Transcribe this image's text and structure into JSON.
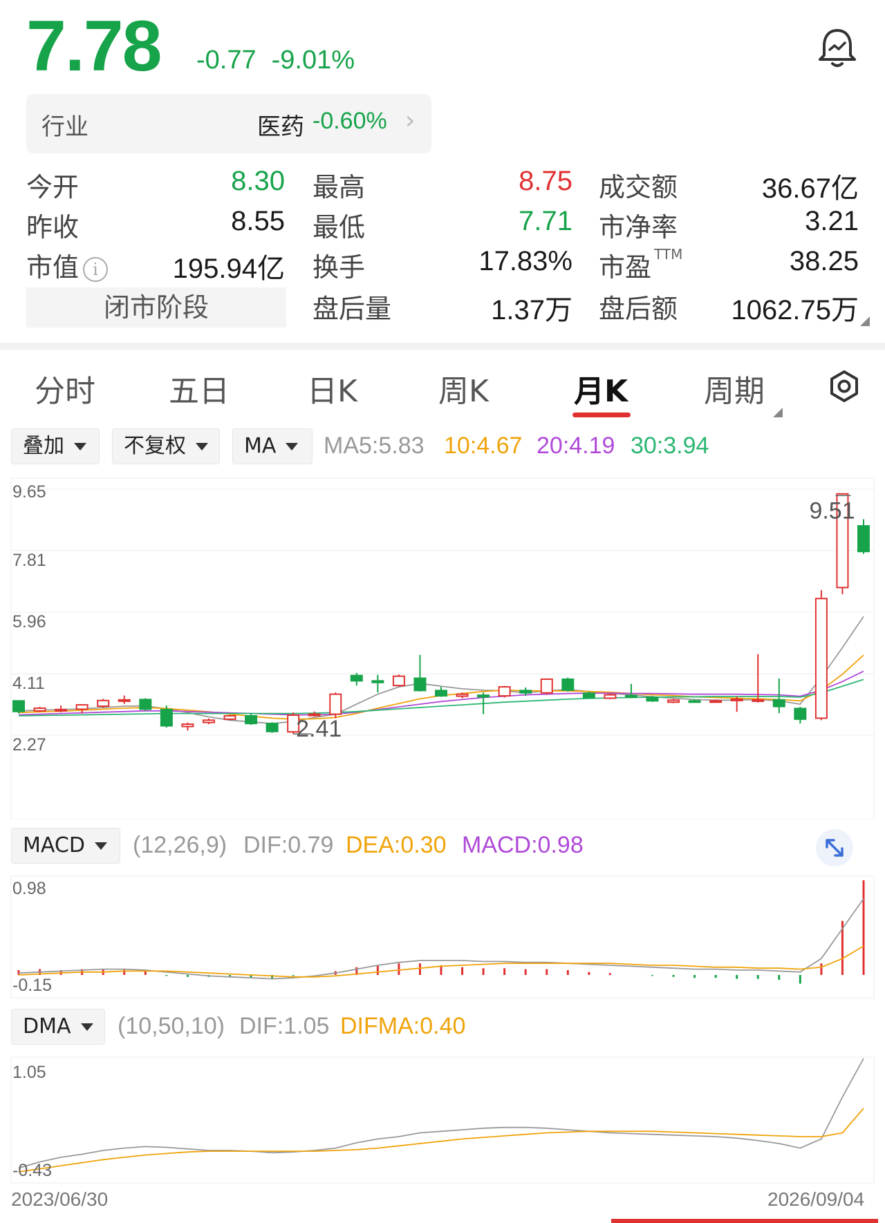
{
  "quote": {
    "price": "7.78",
    "change": "-0.77",
    "change_pct": "-9.01%"
  },
  "industry": {
    "label": "行业",
    "name": "医药",
    "pct": "-0.60%"
  },
  "stats": {
    "open_label": "今开",
    "open": "8.30",
    "prev_label": "昨收",
    "prev": "8.55",
    "mcap_label": "市值",
    "mcap": "195.94亿",
    "session": "闭市阶段",
    "high_label": "最高",
    "high": "8.75",
    "low_label": "最低",
    "low": "7.71",
    "turnover_label": "换手",
    "turnover": "17.83%",
    "after_vol_label": "盘后量",
    "after_vol": "1.37万",
    "amount_label": "成交额",
    "amount": "36.67亿",
    "pb_label": "市净率",
    "pb": "3.21",
    "pe_label": "市盈",
    "pe_sup": "TTM",
    "pe": "38.25",
    "after_amt_label": "盘后额",
    "after_amt": "1062.75万"
  },
  "tabs": [
    "分时",
    "五日",
    "日K",
    "周K",
    "月K",
    "周期"
  ],
  "active_tab": "月K",
  "controls": {
    "overlay": "叠加",
    "adjust": "不复权",
    "ma": "MA"
  },
  "ma_legend": {
    "ma5": "MA5:5.83",
    "ma10": "10:4.67",
    "ma20": "20:4.19",
    "ma30": "30:3.94"
  },
  "macd_header": {
    "name": "MACD",
    "params": "(12,26,9)",
    "dif": "DIF:0.79",
    "dea": "DEA:0.30",
    "macd": "MACD:0.98"
  },
  "dma_header": {
    "name": "DMA",
    "params": "(10,50,10)",
    "dif": "DIF:1.05",
    "difma": "DIFMA:0.40"
  },
  "dates": {
    "start": "2023/06/30",
    "end": "2026/09/04"
  },
  "colors": {
    "up": "#e03131",
    "down": "#17a34a",
    "ma5": "#999999",
    "ma10": "#f0a30a",
    "ma20": "#b04ad8",
    "ma30": "#2bb673"
  },
  "chart_data": [
    {
      "type": "candlestick",
      "title": "月K",
      "y_ticks": [
        "9.65",
        "7.81",
        "5.96",
        "4.11",
        "2.27"
      ],
      "ylim": [
        2.27,
        9.65
      ],
      "annotations": [
        {
          "label": "9.51",
          "kind": "max"
        },
        {
          "label": "2.41",
          "kind": "min"
        }
      ],
      "candles": [
        {
          "o": 3.3,
          "c": 2.98,
          "h": 3.32,
          "l": 2.92
        },
        {
          "o": 3.0,
          "c": 3.08,
          "h": 3.12,
          "l": 2.96
        },
        {
          "o": 3.02,
          "c": 3.04,
          "h": 3.16,
          "l": 2.96
        },
        {
          "o": 3.05,
          "c": 3.18,
          "h": 3.2,
          "l": 2.92
        },
        {
          "o": 3.14,
          "c": 3.31,
          "h": 3.36,
          "l": 3.09
        },
        {
          "o": 3.29,
          "c": 3.33,
          "h": 3.46,
          "l": 3.21
        },
        {
          "o": 3.34,
          "c": 3.05,
          "h": 3.38,
          "l": 3.0
        },
        {
          "o": 3.04,
          "c": 2.55,
          "h": 3.16,
          "l": 2.5
        },
        {
          "o": 2.53,
          "c": 2.6,
          "h": 2.65,
          "l": 2.41
        },
        {
          "o": 2.65,
          "c": 2.72,
          "h": 2.77,
          "l": 2.6
        },
        {
          "o": 2.75,
          "c": 2.85,
          "h": 2.88,
          "l": 2.72
        },
        {
          "o": 2.85,
          "c": 2.62,
          "h": 2.92,
          "l": 2.58
        },
        {
          "o": 2.62,
          "c": 2.38,
          "h": 2.66,
          "l": 2.34
        },
        {
          "o": 2.37,
          "c": 2.87,
          "h": 2.95,
          "l": 2.31
        },
        {
          "o": 2.87,
          "c": 2.9,
          "h": 2.98,
          "l": 2.83
        },
        {
          "o": 2.9,
          "c": 3.5,
          "h": 3.55,
          "l": 2.78
        },
        {
          "o": 4.06,
          "c": 3.9,
          "h": 4.14,
          "l": 3.76
        },
        {
          "o": 3.9,
          "c": 3.85,
          "h": 4.08,
          "l": 3.55
        },
        {
          "o": 3.76,
          "c": 4.04,
          "h": 4.09,
          "l": 3.73
        },
        {
          "o": 3.98,
          "c": 3.61,
          "h": 4.68,
          "l": 3.58
        },
        {
          "o": 3.61,
          "c": 3.45,
          "h": 3.72,
          "l": 3.42
        },
        {
          "o": 3.44,
          "c": 3.5,
          "h": 3.55,
          "l": 3.38
        },
        {
          "o": 3.47,
          "c": 3.42,
          "h": 3.55,
          "l": 2.9
        },
        {
          "o": 3.45,
          "c": 3.72,
          "h": 3.75,
          "l": 3.4
        },
        {
          "o": 3.61,
          "c": 3.54,
          "h": 3.7,
          "l": 3.45
        },
        {
          "o": 3.54,
          "c": 3.95,
          "h": 3.97,
          "l": 3.49
        },
        {
          "o": 3.95,
          "c": 3.62,
          "h": 4.0,
          "l": 3.58
        },
        {
          "o": 3.53,
          "c": 3.4,
          "h": 3.58,
          "l": 3.37
        },
        {
          "o": 3.38,
          "c": 3.48,
          "h": 3.52,
          "l": 3.35
        },
        {
          "o": 3.46,
          "c": 3.41,
          "h": 3.81,
          "l": 3.38
        },
        {
          "o": 3.41,
          "c": 3.3,
          "h": 3.45,
          "l": 3.27
        },
        {
          "o": 3.26,
          "c": 3.32,
          "h": 3.36,
          "l": 3.23
        },
        {
          "o": 3.3,
          "c": 3.28,
          "h": 3.34,
          "l": 3.25
        },
        {
          "o": 3.28,
          "c": 3.3,
          "h": 3.34,
          "l": 3.25
        },
        {
          "o": 3.32,
          "c": 3.35,
          "h": 3.43,
          "l": 2.97
        },
        {
          "o": 3.32,
          "c": 3.33,
          "h": 4.7,
          "l": 3.25
        },
        {
          "o": 3.33,
          "c": 3.13,
          "h": 3.97,
          "l": 2.93
        },
        {
          "o": 3.07,
          "c": 2.75,
          "h": 3.12,
          "l": 2.62
        },
        {
          "o": 2.78,
          "c": 6.37,
          "h": 6.62,
          "l": 2.72
        },
        {
          "o": 6.7,
          "c": 9.51,
          "h": 9.52,
          "l": 6.5
        },
        {
          "o": 8.55,
          "c": 7.78,
          "h": 8.75,
          "l": 7.71
        }
      ],
      "ma_series": [
        {
          "name": "MA5",
          "values": [
            3.0,
            3.02,
            3.04,
            3.06,
            3.1,
            3.14,
            3.15,
            3.06,
            2.95,
            2.82,
            2.72,
            2.67,
            2.62,
            2.68,
            2.8,
            2.9,
            3.2,
            3.5,
            3.72,
            3.82,
            3.74,
            3.66,
            3.62,
            3.6,
            3.54,
            3.6,
            3.64,
            3.58,
            3.52,
            3.48,
            3.42,
            3.38,
            3.34,
            3.32,
            3.32,
            3.34,
            3.3,
            3.2,
            4.0,
            4.9,
            5.83
          ]
        },
        {
          "name": "10",
          "values": [
            2.95,
            2.97,
            2.99,
            3.02,
            3.05,
            3.08,
            3.1,
            3.07,
            3.02,
            2.97,
            2.9,
            2.84,
            2.78,
            2.75,
            2.76,
            2.8,
            2.92,
            3.08,
            3.22,
            3.36,
            3.46,
            3.52,
            3.58,
            3.62,
            3.6,
            3.6,
            3.6,
            3.58,
            3.56,
            3.52,
            3.48,
            3.46,
            3.42,
            3.4,
            3.38,
            3.36,
            3.34,
            3.3,
            3.62,
            4.1,
            4.67
          ]
        },
        {
          "name": "20",
          "values": [
            2.88,
            2.9,
            2.92,
            2.94,
            2.96,
            2.98,
            3.0,
            3.0,
            2.98,
            2.96,
            2.94,
            2.92,
            2.9,
            2.88,
            2.88,
            2.9,
            2.96,
            3.04,
            3.12,
            3.2,
            3.28,
            3.34,
            3.4,
            3.44,
            3.48,
            3.5,
            3.52,
            3.53,
            3.53,
            3.52,
            3.52,
            3.51,
            3.5,
            3.5,
            3.5,
            3.49,
            3.48,
            3.44,
            3.62,
            3.88,
            4.19
          ]
        },
        {
          "name": "30",
          "values": [
            2.85,
            2.86,
            2.87,
            2.88,
            2.89,
            2.9,
            2.91,
            2.92,
            2.92,
            2.92,
            2.92,
            2.92,
            2.92,
            2.92,
            2.93,
            2.95,
            2.98,
            3.02,
            3.06,
            3.1,
            3.14,
            3.18,
            3.22,
            3.26,
            3.29,
            3.32,
            3.35,
            3.37,
            3.39,
            3.4,
            3.41,
            3.42,
            3.42,
            3.43,
            3.43,
            3.43,
            3.43,
            3.41,
            3.54,
            3.74,
            3.94
          ]
        }
      ]
    },
    {
      "type": "bar",
      "title": "MACD",
      "y_ticks": [
        "0.98",
        "-0.15"
      ],
      "ylim": [
        -0.15,
        0.98
      ],
      "macd_bars": [
        0.05,
        0.06,
        0.05,
        0.06,
        0.06,
        0.06,
        0.04,
        -0.01,
        -0.02,
        -0.02,
        -0.02,
        -0.03,
        -0.04,
        -0.01,
        0.0,
        0.04,
        0.08,
        0.1,
        0.12,
        0.12,
        0.1,
        0.08,
        0.07,
        0.07,
        0.06,
        0.06,
        0.05,
        0.03,
        0.02,
        0.0,
        -0.01,
        -0.02,
        -0.03,
        -0.03,
        -0.04,
        -0.04,
        -0.05,
        -0.09,
        0.12,
        0.56,
        0.98
      ],
      "series": [
        {
          "name": "DIF",
          "values": [
            0.02,
            0.03,
            0.04,
            0.05,
            0.06,
            0.06,
            0.05,
            0.03,
            0.01,
            -0.01,
            -0.02,
            -0.03,
            -0.04,
            -0.03,
            -0.01,
            0.02,
            0.06,
            0.1,
            0.13,
            0.15,
            0.15,
            0.15,
            0.14,
            0.14,
            0.13,
            0.13,
            0.12,
            0.11,
            0.1,
            0.09,
            0.08,
            0.07,
            0.06,
            0.06,
            0.05,
            0.05,
            0.04,
            0.03,
            0.17,
            0.48,
            0.79
          ]
        },
        {
          "name": "DEA",
          "values": [
            0.0,
            0.01,
            0.02,
            0.03,
            0.03,
            0.04,
            0.04,
            0.04,
            0.03,
            0.02,
            0.01,
            0.0,
            -0.01,
            -0.02,
            -0.02,
            -0.01,
            0.01,
            0.03,
            0.05,
            0.07,
            0.09,
            0.1,
            0.11,
            0.12,
            0.12,
            0.12,
            0.12,
            0.12,
            0.12,
            0.11,
            0.1,
            0.1,
            0.09,
            0.08,
            0.08,
            0.07,
            0.07,
            0.06,
            0.08,
            0.17,
            0.3
          ]
        }
      ]
    },
    {
      "type": "line",
      "title": "DMA",
      "y_ticks": [
        "1.05",
        "-0.43"
      ],
      "ylim": [
        -0.43,
        1.05
      ],
      "series": [
        {
          "name": "DIF",
          "values": [
            -0.38,
            -0.3,
            -0.24,
            -0.2,
            -0.15,
            -0.12,
            -0.1,
            -0.11,
            -0.13,
            -0.15,
            -0.15,
            -0.16,
            -0.18,
            -0.17,
            -0.15,
            -0.12,
            -0.05,
            0.0,
            0.03,
            0.08,
            0.1,
            0.12,
            0.14,
            0.15,
            0.15,
            0.14,
            0.12,
            0.1,
            0.08,
            0.07,
            0.06,
            0.05,
            0.04,
            0.03,
            0.01,
            -0.02,
            -0.06,
            -0.12,
            0.0,
            0.55,
            1.05
          ]
        },
        {
          "name": "DIFMA",
          "values": [
            -0.43,
            -0.39,
            -0.35,
            -0.31,
            -0.27,
            -0.24,
            -0.21,
            -0.19,
            -0.17,
            -0.16,
            -0.16,
            -0.16,
            -0.16,
            -0.16,
            -0.16,
            -0.15,
            -0.14,
            -0.12,
            -0.09,
            -0.06,
            -0.03,
            0.0,
            0.02,
            0.04,
            0.06,
            0.08,
            0.09,
            0.1,
            0.1,
            0.1,
            0.1,
            0.09,
            0.08,
            0.07,
            0.06,
            0.05,
            0.04,
            0.03,
            0.03,
            0.08,
            0.4
          ]
        }
      ]
    }
  ]
}
